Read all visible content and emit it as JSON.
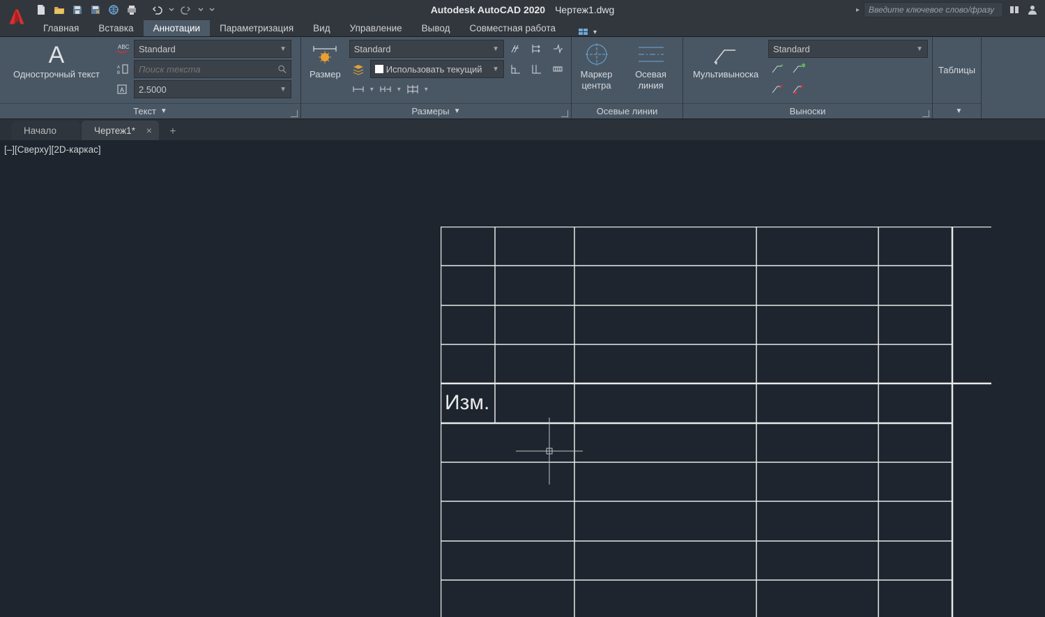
{
  "titlebar": {
    "app": "Autodesk AutoCAD 2020",
    "document": "Чертеж1.dwg",
    "search_placeholder": "Введите ключевое слово/фразу"
  },
  "menutabs": [
    "Главная",
    "Вставка",
    "Аннотации",
    "Параметризация",
    "Вид",
    "Управление",
    "Вывод",
    "Совместная работа"
  ],
  "active_menu_index": 2,
  "ribbon": {
    "text_panel": {
      "big_label": "Однострочный текст",
      "style_dd": "Standard",
      "search_placeholder": "Поиск текста",
      "height_val": "2.5000",
      "title": "Текст"
    },
    "dim_panel": {
      "big_label": "Размер",
      "style_dd": "Standard",
      "layer_dd": "Использовать текущий",
      "title": "Размеры"
    },
    "center_panel": {
      "btn1": "Маркер центра",
      "btn2": "Осевая линия",
      "title": "Осевые линии"
    },
    "leader_panel": {
      "big_label": "Мультивыноска",
      "style_dd": "Standard",
      "title": "Выноски"
    },
    "tables_panel": {
      "big_label": "Таблицы"
    }
  },
  "doctabs": {
    "tab1": "Начало",
    "tab2": "Чертеж1*"
  },
  "viewport": {
    "label": "[–][Сверху][2D-каркас]",
    "cell_text": "Изм."
  }
}
